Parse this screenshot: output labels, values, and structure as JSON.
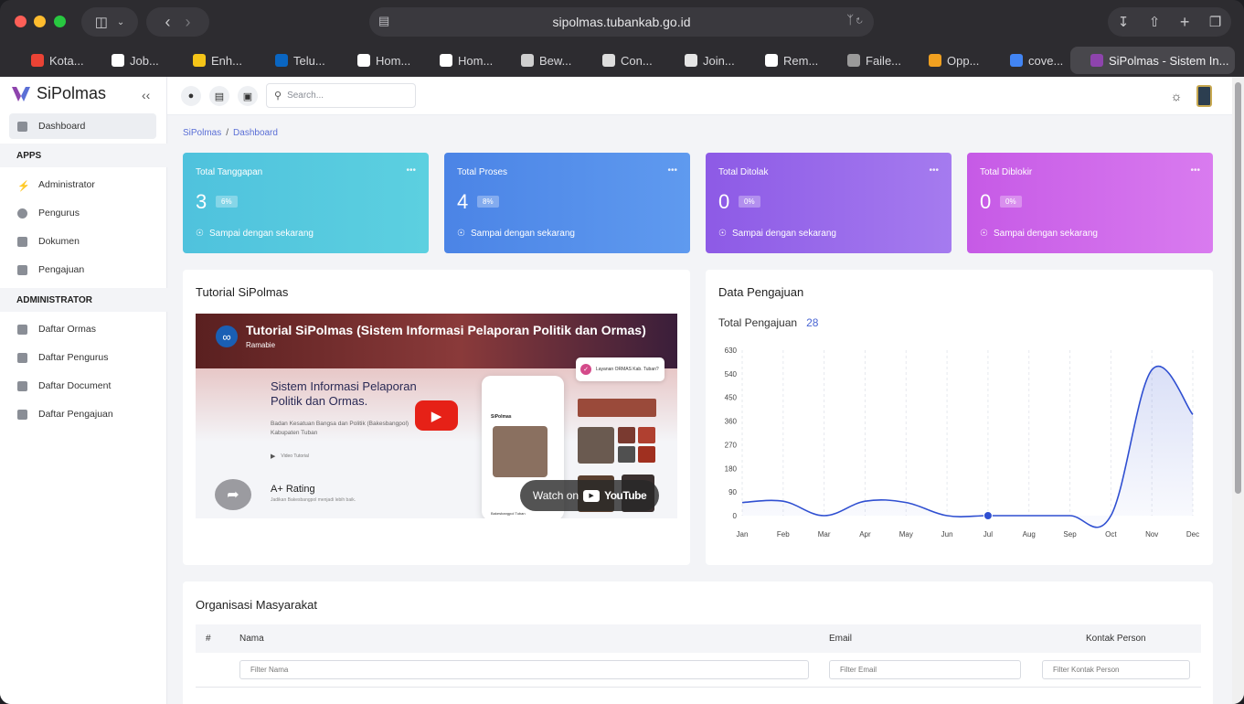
{
  "browser": {
    "url": "sipolmas.tubankab.go.id",
    "tabs": [
      {
        "label": "Kota...",
        "icon": "gmail-icon",
        "color": "#ea4335"
      },
      {
        "label": "Job...",
        "icon": "word-icon",
        "color": "#ffffff"
      },
      {
        "label": "Enh...",
        "icon": "smile-icon",
        "color": "#f5c518"
      },
      {
        "label": "Telu...",
        "icon": "linkedin-icon",
        "color": "#0a66c2"
      },
      {
        "label": "Hom...",
        "icon": "j-icon",
        "color": "#ffffff"
      },
      {
        "label": "Hom...",
        "icon": "j-icon",
        "color": "#ffffff"
      },
      {
        "label": "Bew...",
        "icon": "page-icon",
        "color": "#cfcfcf"
      },
      {
        "label": "Con...",
        "icon": "openai-icon",
        "color": "#dddddd"
      },
      {
        "label": "Join...",
        "icon": "visio-icon",
        "color": "#e5e5e5"
      },
      {
        "label": "Rem...",
        "icon": "wix-icon",
        "color": "#ffffff"
      },
      {
        "label": "Faile...",
        "icon": "r-icon",
        "color": "#9a9a9a"
      },
      {
        "label": "Opp...",
        "icon": "star-icon",
        "color": "#f0a020"
      },
      {
        "label": "cove...",
        "icon": "docs-icon",
        "color": "#4285f4"
      },
      {
        "label": "SiPolmas - Sistem In...",
        "icon": "sipolmas-icon",
        "color": "#8e44ad"
      }
    ]
  },
  "sidebar": {
    "brand": "SiPolmas",
    "dashboard": "Dashboard",
    "section_apps": "APPS",
    "apps": [
      "Administrator",
      "Pengurus",
      "Dokumen",
      "Pengajuan"
    ],
    "section_admin": "ADMINISTRATOR",
    "admin": [
      "Daftar Ormas",
      "Daftar Pengurus",
      "Daftar Document",
      "Daftar Pengajuan"
    ]
  },
  "topbar": {
    "search_placeholder": "Search..."
  },
  "breadcrumb": {
    "root": "SiPolmas",
    "current": "Dashboard"
  },
  "cards": [
    {
      "title": "Total Tanggapan",
      "value": "3",
      "percent": "6%",
      "subtitle": "Sampai dengan sekarang"
    },
    {
      "title": "Total Proses",
      "value": "4",
      "percent": "8%",
      "subtitle": "Sampai dengan sekarang"
    },
    {
      "title": "Total Ditolak",
      "value": "0",
      "percent": "0%",
      "subtitle": "Sampai dengan sekarang"
    },
    {
      "title": "Total Diblokir",
      "value": "0",
      "percent": "0%",
      "subtitle": "Sampai dengan sekarang"
    }
  ],
  "tutorial": {
    "title": "Tutorial SiPolmas",
    "video_title": "Tutorial SiPolmas (Sistem Informasi Pelaporan Politik dan Ormas)",
    "channel": "Ramabie",
    "headline": "Sistem Informasi Pelaporan Politik dan Ormas.",
    "body": "Badan Kesatuan Bangsa dan Politik (Bakesbangpol) Kabupaten Tuban",
    "watch": "Watch on",
    "youtube": "YouTube",
    "rating": "A+ Rating",
    "rating_sub": "Jadikan Bakesbangpol menjadi lebih baik.",
    "video_label": "Video Tutorial",
    "bubble": "Layanan ORMAS Kab. Tuban?",
    "app_name": "SiPolmas",
    "app_footer": "Bakesbangpol Tuban"
  },
  "chart_panel": {
    "title": "Data Pengajuan",
    "total_label": "Total Pengajuan",
    "total_value": "28"
  },
  "chart_data": {
    "type": "area",
    "categories": [
      "Jan",
      "Feb",
      "Mar",
      "Apr",
      "May",
      "Jun",
      "Jul",
      "Aug",
      "Sep",
      "Oct",
      "Nov",
      "Dec"
    ],
    "series": [
      {
        "values": [
          50,
          55,
          0,
          55,
          50,
          0,
          0,
          0,
          0,
          0,
          555,
          385
        ]
      }
    ],
    "yticks": [
      0,
      90,
      180,
      270,
      360,
      450,
      540,
      630
    ],
    "ylim": [
      0,
      630
    ],
    "highlight_category": "Jul",
    "color": "#2f4fd1"
  },
  "ormas": {
    "title": "Organisasi Masyarakat",
    "columns": [
      "#",
      "Nama",
      "Email",
      "Kontak Person"
    ],
    "filters": {
      "nama": "Filter Nama",
      "email": "Filter Email",
      "kontak": "Filter Kontak Person"
    }
  }
}
